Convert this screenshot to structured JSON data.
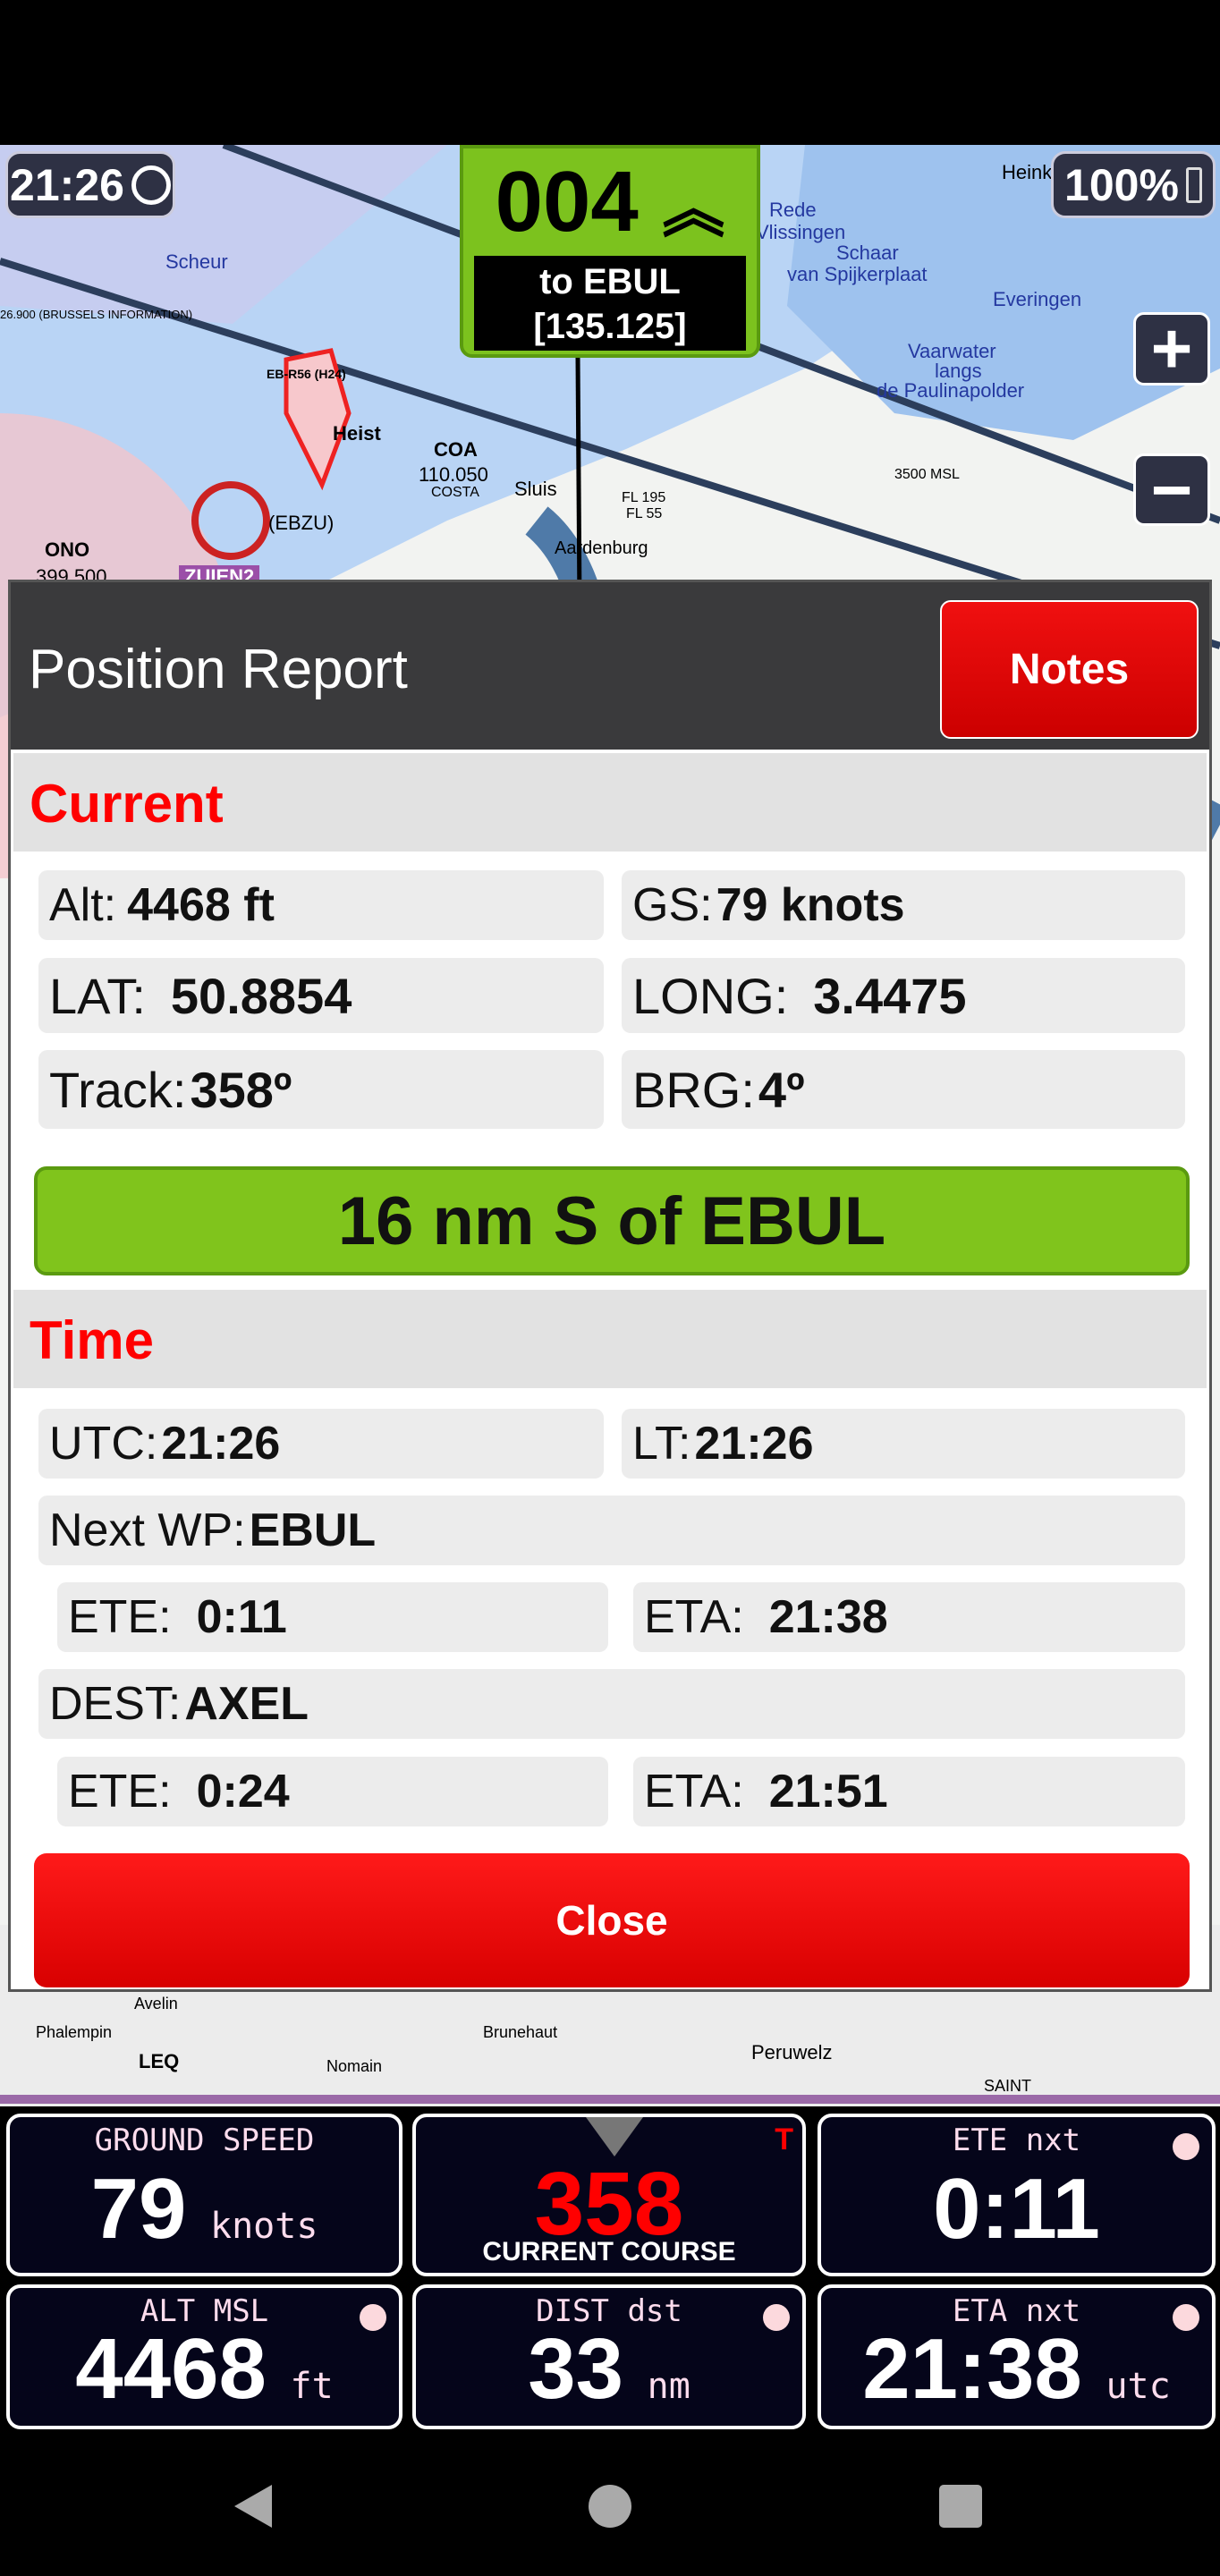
{
  "status": {
    "time": "21:26",
    "battery": "100%"
  },
  "map": {
    "heading": "004",
    "next_target": "to EBUL",
    "frequency": "[135.125]",
    "labels": [
      "Heinkenszand",
      "Rede",
      "Vlissingen",
      "Schaar",
      "van Spijkerplaat",
      "Everingen",
      "Vaarwater",
      "langs",
      "de Paulinapolder",
      "Scheur",
      "EB-R56 (H24)",
      "Heist",
      "COA",
      "110.050",
      "COSTA",
      "Sluis",
      "FL 195",
      "FL 55",
      "3500 MSL",
      "Aardenburg",
      "ONO",
      "399.500",
      "ZUIEN2",
      "(EBZU)",
      "26.900 (BRUSSELS INFORMATION)",
      "Avelin",
      "Phalempin",
      "LEQ",
      "Nomain",
      "Peruwelz",
      "Brunehaut",
      "SAINT"
    ]
  },
  "dialog": {
    "title": "Position Report",
    "notes_label": "Notes",
    "current_header": "Current",
    "alt": {
      "label": "Alt:",
      "value": "4468 ft"
    },
    "gs": {
      "label": "GS:",
      "value": "79 knots"
    },
    "lat": {
      "label": "LAT:",
      "value": "50.8854"
    },
    "long": {
      "label": "LONG:",
      "value": "3.4475"
    },
    "track": {
      "label": "Track:",
      "value": "358º"
    },
    "brg": {
      "label": "BRG:",
      "value": "4º"
    },
    "location": "16 nm S of EBUL",
    "time_header": "Time",
    "utc": {
      "label": "UTC:",
      "value": "21:26"
    },
    "lt": {
      "label": "LT:",
      "value": "21:26"
    },
    "next_wp": {
      "label": "Next WP:",
      "value": "EBUL"
    },
    "next_ete": {
      "label": "ETE:",
      "value": "0:11"
    },
    "next_eta": {
      "label": "ETA:",
      "value": "21:38"
    },
    "dest": {
      "label": "DEST:",
      "value": "AXEL"
    },
    "dest_ete": {
      "label": "ETE:",
      "value": "0:24"
    },
    "dest_eta": {
      "label": "ETA:",
      "value": "21:51"
    },
    "close_label": "Close"
  },
  "instruments": [
    {
      "label": "GROUND SPEED",
      "value": "79",
      "unit": "knots"
    },
    {
      "label": "CURRENT COURSE",
      "value": "358",
      "unit": "",
      "flag": "T"
    },
    {
      "label": "ETE nxt",
      "value": "0:11",
      "unit": ""
    },
    {
      "label": "ALT MSL",
      "value": "4468",
      "unit": "ft"
    },
    {
      "label": "DIST dst",
      "value": "33",
      "unit": "nm"
    },
    {
      "label": "ETA nxt",
      "value": "21:38",
      "unit": "utc"
    }
  ],
  "colors": {
    "accent_green": "#7cc21e",
    "alert_red": "#ff0000",
    "header_dark": "#3a3a3c",
    "instrument_bg": "#05051a"
  }
}
